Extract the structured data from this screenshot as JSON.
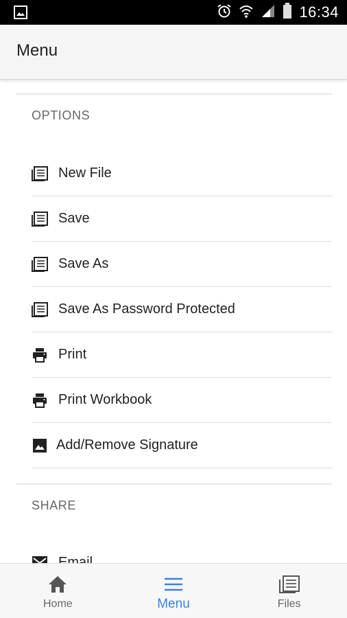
{
  "status_bar": {
    "time": "16:34",
    "icons": [
      "gallery-icon",
      "alarm-icon",
      "wifi-icon",
      "signal-icon",
      "battery-icon"
    ]
  },
  "app_bar": {
    "title": "Menu"
  },
  "sections": {
    "options": {
      "label": "OPTIONS",
      "items": [
        {
          "label": "New File",
          "icon": "document-icon"
        },
        {
          "label": "Save",
          "icon": "document-icon"
        },
        {
          "label": "Save As",
          "icon": "document-icon"
        },
        {
          "label": "Save As Password Protected",
          "icon": "document-icon"
        },
        {
          "label": "Print",
          "icon": "printer-icon"
        },
        {
          "label": "Print Workbook",
          "icon": "printer-icon"
        },
        {
          "label": "Add/Remove Signature",
          "icon": "image-icon"
        }
      ]
    },
    "share": {
      "label": "SHARE",
      "items": [
        {
          "label": "Email",
          "icon": "mail-icon"
        }
      ]
    }
  },
  "bottom_nav": {
    "items": [
      {
        "label": "Home",
        "icon": "home-icon",
        "active": false
      },
      {
        "label": "Menu",
        "icon": "menu-icon",
        "active": true
      },
      {
        "label": "Files",
        "icon": "document-icon",
        "active": false
      }
    ]
  },
  "colors": {
    "accent": "#3b82e0",
    "status_bar": "#000000",
    "app_bar": "#f5f5f5",
    "text": "#212121",
    "secondary_text": "#666666"
  }
}
